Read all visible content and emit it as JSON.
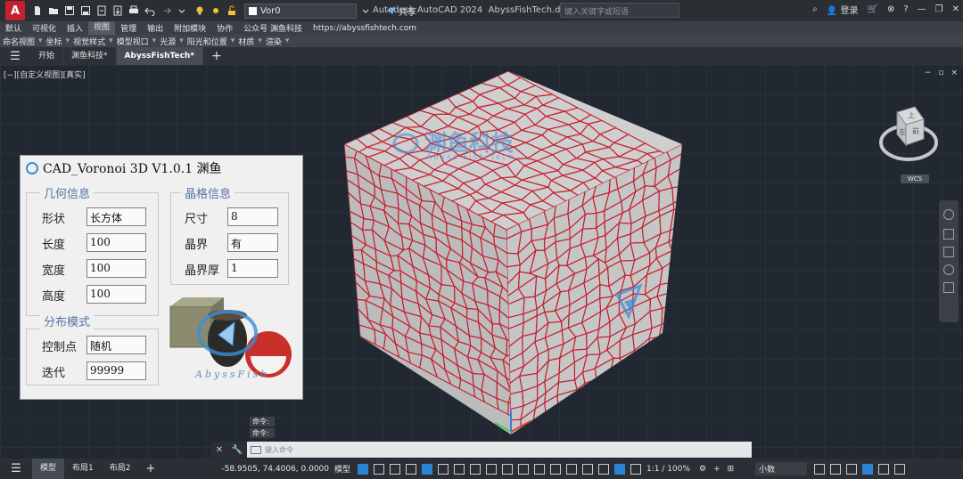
{
  "app": {
    "logo_letter": "A",
    "title": "Autodesk AutoCAD 2024",
    "filename": "AbyssFishTech.dwg",
    "search_placeholder": "键入关键字或短语",
    "login": "登录",
    "share": "共享",
    "layer": "Vor0"
  },
  "ribbon": {
    "tabs": [
      "默认",
      "可视化",
      "插入",
      "视图",
      "管理",
      "输出",
      "附加模块",
      "协作",
      "公众号 渊鱼科技",
      "https://abyssfishtech.com"
    ],
    "active_tab": "视图",
    "panels": [
      "命名视图",
      "坐标",
      "视觉样式",
      "模型视口",
      "光源",
      "阳光和位置",
      "材质",
      "渲染"
    ]
  },
  "file_tabs": {
    "items": [
      "开始",
      "渊鱼科技*",
      "AbyssFishTech*"
    ],
    "active": "AbyssFishTech*",
    "add": "+"
  },
  "viewport": {
    "label": "[−][自定义视图][真实]",
    "controls": [
      "−",
      "▫",
      "×"
    ],
    "viewcube_top": "上",
    "viewcube_left": "左",
    "viewcube_front": "前",
    "wcs": "WCS",
    "watermark": "渊鱼科技",
    "watermark_sub": "Abyss Fish Tech"
  },
  "dialog": {
    "title": "CAD_Voronoi 3D V1.0.1 渊鱼",
    "geometry": {
      "title": "几何信息",
      "fields": [
        {
          "label": "形状",
          "value": "长方体"
        },
        {
          "label": "长度",
          "value": "100"
        },
        {
          "label": "宽度",
          "value": "100"
        },
        {
          "label": "高度",
          "value": "100"
        }
      ]
    },
    "grain": {
      "title": "晶格信息",
      "fields": [
        {
          "label": "尺寸",
          "value": "8"
        },
        {
          "label": "晶界",
          "value": "有"
        },
        {
          "label": "晶界厚",
          "value": "1"
        }
      ]
    },
    "distribution": {
      "title": "分布模式",
      "fields": [
        {
          "label": "控制点",
          "value": "随机"
        },
        {
          "label": "迭代",
          "value": "99999"
        }
      ]
    },
    "logo_text": "AbyssFish"
  },
  "command": {
    "history": [
      "命令:",
      "命令:"
    ],
    "placeholder": "键入命令"
  },
  "status": {
    "tabs": [
      "模型",
      "布局1",
      "布局2"
    ],
    "active_tab": "模型",
    "coords": "-58.9505, 74.4006, 0.0000",
    "mode": "模型",
    "scale": "1:1 / 100%",
    "units": "小数"
  },
  "colors": {
    "accent": "#2a84d3",
    "grain_boundary": "#c4202f",
    "cube_face": "#c9c9c9"
  }
}
